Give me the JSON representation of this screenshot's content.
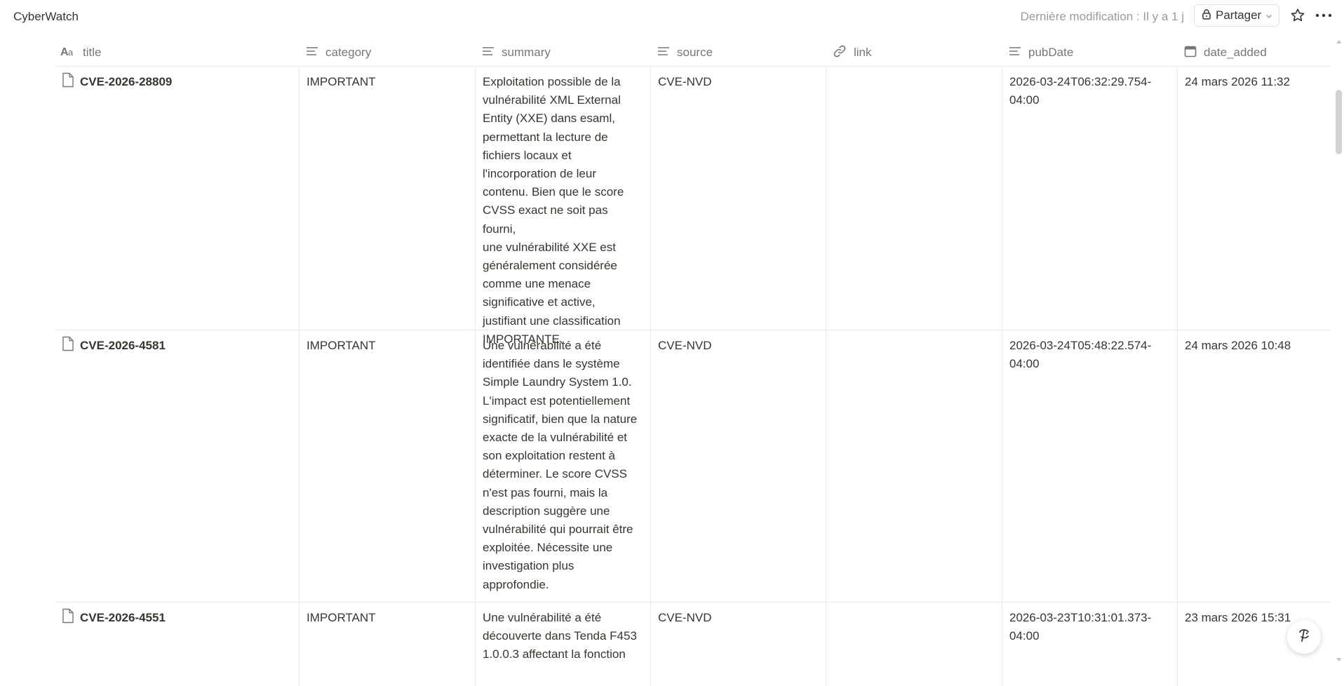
{
  "app": {
    "title": "CyberWatch",
    "last_modified": "Dernière modification : Il y a 1 j",
    "share_label": "Partager"
  },
  "columns": [
    {
      "key": "title",
      "label": "title",
      "icon": "title-aa-icon"
    },
    {
      "key": "category",
      "label": "category",
      "icon": "text-lines-icon"
    },
    {
      "key": "summary",
      "label": "summary",
      "icon": "text-lines-icon"
    },
    {
      "key": "source",
      "label": "source",
      "icon": "text-lines-icon"
    },
    {
      "key": "link",
      "label": "link",
      "icon": "link-icon"
    },
    {
      "key": "pubDate",
      "label": "pubDate",
      "icon": "text-lines-icon"
    },
    {
      "key": "date_added",
      "label": "date_added",
      "icon": "calendar-icon"
    }
  ],
  "rows": [
    {
      "title": "CVE-2026-28809",
      "category": "IMPORTANT",
      "summary": "Exploitation possible de la\nvulnérabilité XML External\nEntity (XXE) dans esaml,\npermettant la lecture de\nfichiers locaux et\nl'incorporation de leur\ncontenu.  Bien que le score\nCVSS exact ne soit pas fourni,\nune vulnérabilité XXE est\ngénéralement considérée\ncomme une menace\nsignificative et active,\njustifiant une classification\nIMPORTANTE.",
      "source": "CVE-NVD",
      "link": "",
      "pubDate": "2026-03-24T06:32:29.754-\n04:00",
      "date_added": "24 mars 2026 11:32"
    },
    {
      "title": "CVE-2026-4581",
      "category": "IMPORTANT",
      "summary": "Une vulnérabilité a été\nidentifiée dans le système\nSimple Laundry System 1.0.\nL'impact est potentiellement\nsignificatif, bien que la nature\nexacte de la vulnérabilité et\nson exploitation restent à\ndéterminer.  Le score CVSS\nn'est pas fourni, mais la\ndescription suggère une\nvulnérabilité qui pourrait être\nexploitée.  Nécessite une\ninvestigation plus\napprofondie.",
      "source": "CVE-NVD",
      "link": "",
      "pubDate": "2026-03-24T05:48:22.574-\n04:00",
      "date_added": "24 mars 2026 10:48"
    },
    {
      "title": "CVE-2026-4551",
      "category": "IMPORTANT",
      "summary": "Une vulnérabilité a été\ndécouverte dans Tenda F453\n1.0.0.3 affectant la fonction",
      "source": "CVE-NVD",
      "link": "",
      "pubDate": "2026-03-23T10:31:01.373-\n04:00",
      "date_added": "23 mars 2026 15:31"
    }
  ],
  "colors": {
    "text": "#37352f",
    "muted": "#787774",
    "border": "#e9e9e7"
  }
}
